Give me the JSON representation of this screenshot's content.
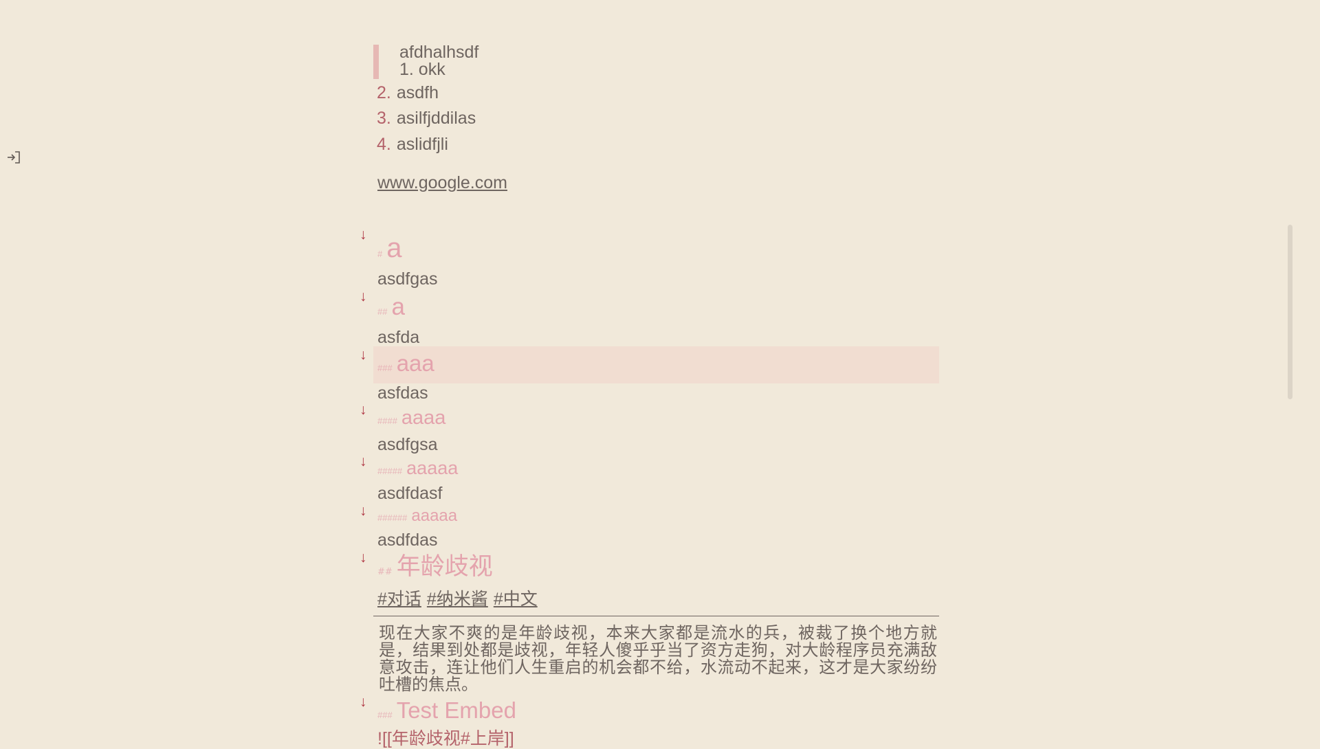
{
  "colors": {
    "background": "#f1e9da",
    "text": "#6e6560",
    "heading": "#e4a3ad",
    "list_number": "#b4626a",
    "fold_arrow": "#b03a46",
    "highlight": "#f1ddd1",
    "blockquote_bar": "#e6b8b4"
  },
  "sidebar": {
    "toggle_icon": "sidebar-expand-icon"
  },
  "blockquote": {
    "line1": "afdhalhsdf",
    "line2": "1. okk"
  },
  "ordered_list": [
    {
      "number": "2.",
      "text": "asdfh"
    },
    {
      "number": "3.",
      "text": "asilfjddilas"
    },
    {
      "number": "4.",
      "text": "aslidfjli"
    }
  ],
  "link": "www.google.com",
  "fold_arrow_glyph": "↓",
  "sections": [
    {
      "marks": "#",
      "title": "a",
      "body": "asdfgas"
    },
    {
      "marks": "##",
      "title": "a",
      "body": "asfda"
    },
    {
      "marks": "###",
      "title": "aaa",
      "body": "asfdas"
    },
    {
      "marks": "####",
      "title": "aaaa",
      "body": "asdfgsa"
    },
    {
      "marks": "#####",
      "title": "aaaaa",
      "body": "asdfdasf"
    },
    {
      "marks": "######",
      "title": "aaaaa",
      "body": "asdfdas"
    },
    {
      "marks": "##",
      "title": "年龄歧视"
    },
    {
      "marks": "###",
      "title": "Test Embed"
    }
  ],
  "tags": [
    "#对话",
    "#纳米酱",
    "#中文"
  ],
  "chinese_paragraph": "现在大家不爽的是年龄歧视，本来大家都是流水的兵，被裁了换个地方就是，结果到处都是歧视，年轻人傻乎乎当了资方走狗，对大龄程序员充满敌意攻击，连让他们人生重启的机会都不给，水流动不起来，这才是大家纷纷吐槽的焦点。",
  "embed": "![[年龄歧视#上岸]]"
}
